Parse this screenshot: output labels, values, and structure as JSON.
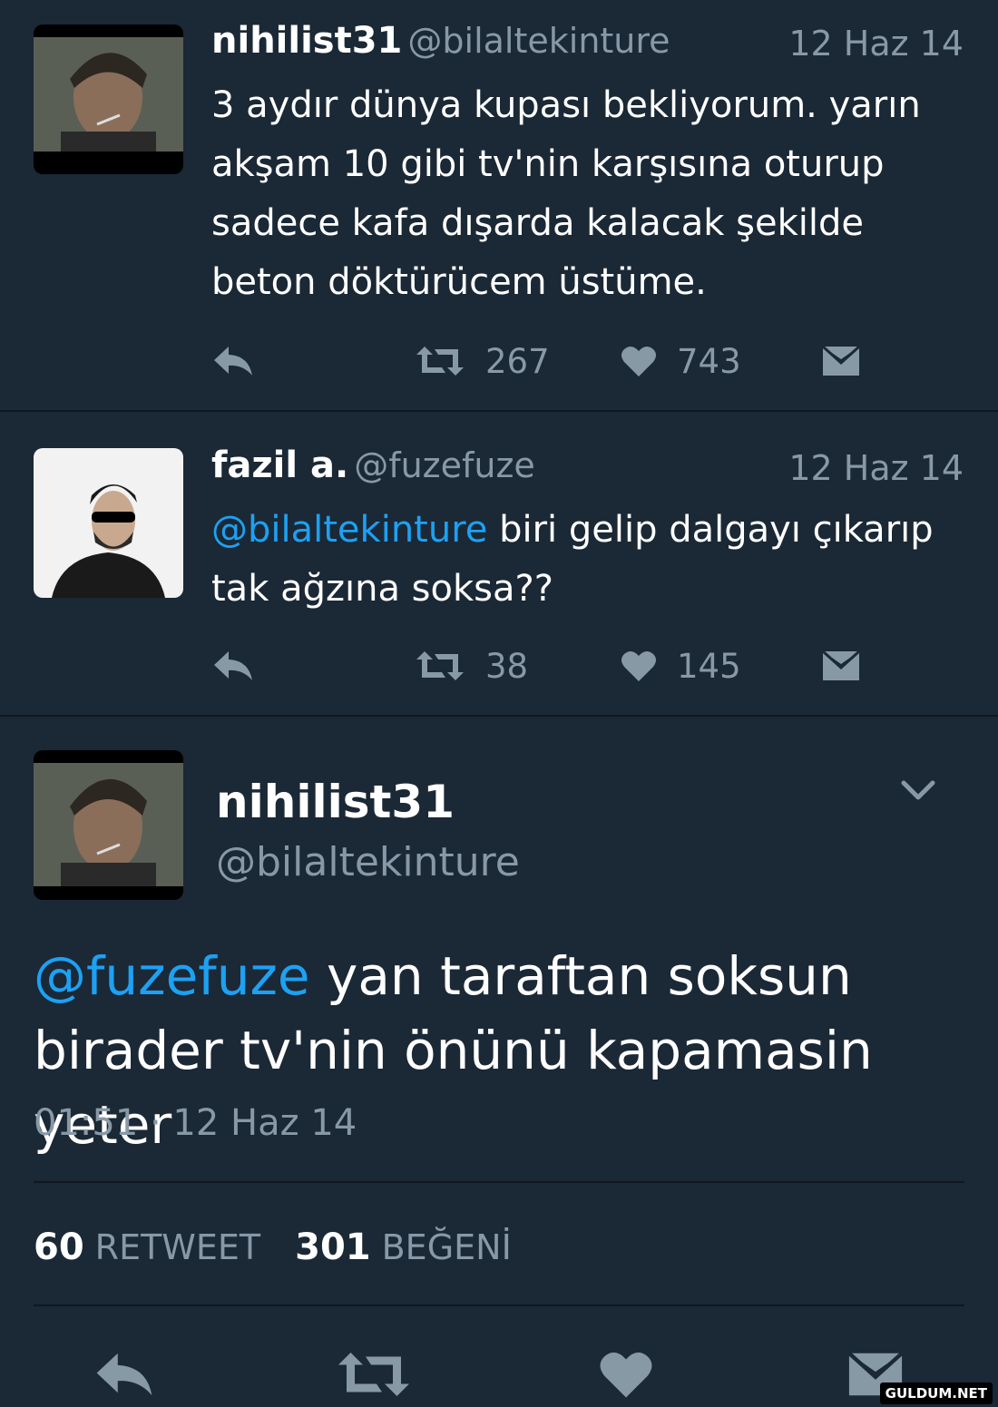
{
  "tweets": [
    {
      "name": "nihilist31",
      "handle": "@bilaltekinture",
      "date": "12 Haz 14",
      "text": "3 aydır dünya kupası bekliyorum. yarın akşam 10 gibi tv'nin karşısına oturup sadece kafa dışarda kalacak şekilde beton döktürücem üstüme.",
      "retweets": "267",
      "likes": "743"
    },
    {
      "name": "fazil a.",
      "handle": "@fuzefuze",
      "date": "12 Haz 14",
      "mention": "@bilaltekinture",
      "text": " biri gelip dalgayı çıkarıp tak ağzına soksa??",
      "retweets": "38",
      "likes": "145"
    }
  ],
  "focused": {
    "name": "nihilist31",
    "handle": "@bilaltekinture",
    "mention": "@fuzefuze",
    "text": " yan taraftan soksun birader tv'nin önünü kapamasin yeter",
    "timestamp": "01:51 · 12 Haz 14",
    "retweet_count": "60",
    "retweet_label": "RETWEET",
    "like_count": "301",
    "like_label": "BEĞENİ"
  },
  "icons": {
    "reply": "reply-icon",
    "retweet": "retweet-icon",
    "like": "heart-icon",
    "message": "envelope-icon",
    "menu": "chevron-down-icon"
  },
  "colors": {
    "background": "#1b2836",
    "mention": "#1da1f2",
    "muted": "#8899a6"
  },
  "watermark": "GULDUM.NET"
}
